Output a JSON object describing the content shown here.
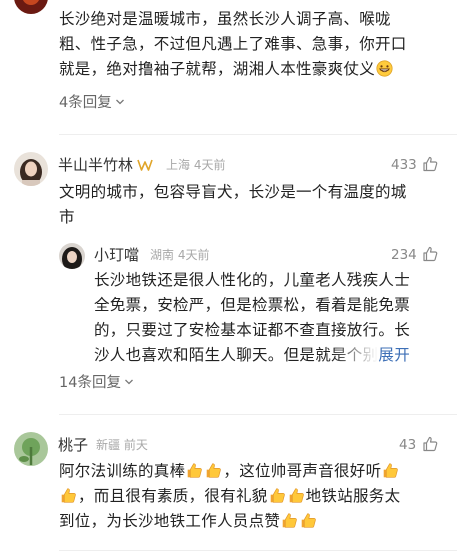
{
  "comments": [
    {
      "id": "c0",
      "text_lines": [
        "长沙绝对是温暖城市，虽然长沙人调子高、喉咙",
        "粗、性子急，不过但凡遇上了难事、急事，你开口",
        "就是，绝对撸袖子就帮，湖湘人本性豪爽仗义"
      ],
      "replies_label": "4条回复"
    },
    {
      "id": "c1",
      "name": "半山半竹林",
      "location": "上海",
      "time": "4天前",
      "likes": "433",
      "text_lines": [
        "文明的城市，包容导盲犬，长沙是一个有温度的城",
        "市"
      ],
      "reply": {
        "name": "小玎噹",
        "location": "湖南",
        "time": "4天前",
        "likes": "234",
        "text_lines": [
          "长沙地铁还是很人性化的，儿童老人残疾人士",
          "全免票，安检严，但是检票松，看着是能免票",
          "的，只要过了安检基本证都不查直接放行。长",
          "沙人也喜欢和陌生人聊天。但是就是个别"
        ],
        "expand_label": "展开"
      },
      "replies_label": "14条回复"
    },
    {
      "id": "c2",
      "name": "桃子",
      "location": "新疆",
      "time": "前天",
      "likes": "43",
      "text_parts": {
        "l1a": "阿尔法训练的真棒",
        "l1b": "，这位帅哥声音很好听",
        "l2a": "，而且很有素质，很有礼貌",
        "l2b": "地铁站服务太",
        "l3a": "到位，为长沙地铁工作人员点赞"
      }
    }
  ],
  "colors": {
    "text": "#222222",
    "meta": "#a8a8a8",
    "link": "#3d6fb6",
    "badge": "#e0a52a"
  },
  "icons": [
    "thumbs-up-icon",
    "chevron-down-icon",
    "thumbs-up-emoji",
    "grin-emoji",
    "vip-badge-icon"
  ]
}
